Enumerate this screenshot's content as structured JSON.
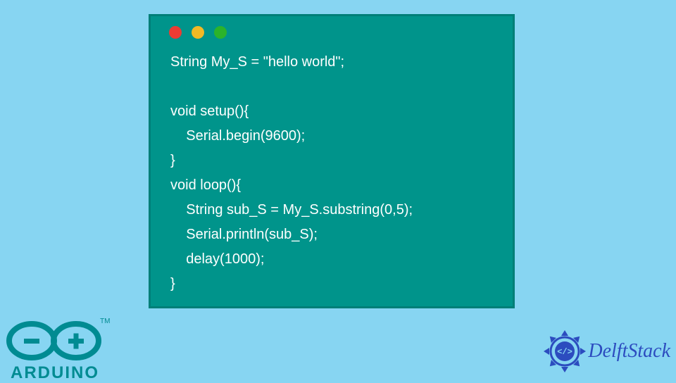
{
  "code": {
    "lines": [
      "String My_S = \"hello world\";",
      "",
      "void setup(){",
      "    Serial.begin(9600);",
      "}",
      "void loop(){",
      "    String sub_S = My_S.substring(0,5);",
      "    Serial.println(sub_S);",
      "    delay(1000);",
      "}"
    ]
  },
  "logos": {
    "arduino_label": "ARDUINO",
    "delft_label": "DelftStack"
  },
  "colors": {
    "bg": "#87d5f2",
    "window": "#00948b",
    "window_border": "#007f78",
    "code_text": "#ffffff",
    "arduino": "#008b92",
    "delft": "#2c4cbf"
  }
}
